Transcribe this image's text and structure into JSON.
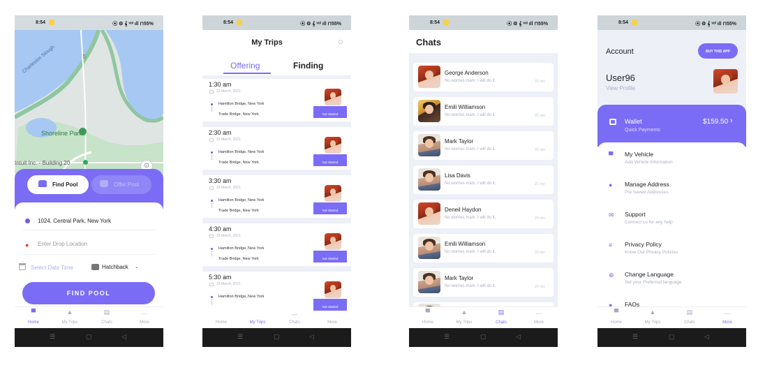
{
  "status_bar": {
    "time": "8:54",
    "icons": "⦿ ⚙ 𝄞 ᵛᵒˡ ıll ⊓55%"
  },
  "bottom_nav": {
    "home": "Home",
    "trips": "My Trips",
    "chats": "Chats",
    "more": "More"
  },
  "android_nav": {
    "menu": "☰",
    "home": "▢",
    "back": "◁"
  },
  "screen1": {
    "map": {
      "labels": [
        "Charleston Slough",
        "Shoreline Park",
        "Intuit Inc. - Building 20",
        "A1"
      ]
    },
    "tabs": {
      "find": "Find Pool",
      "offer": "Offer Pool"
    },
    "pickup": "1024, Central Park, New York",
    "drop_placeholder": "Enter Drop Location",
    "date_placeholder": "Select Date Time",
    "vehicle": "Hatchback",
    "button": "FIND POOL"
  },
  "screen2": {
    "title": "My Trips",
    "tabs": {
      "offering": "Offering",
      "finding": "Finding"
    },
    "trips": [
      {
        "time": "1:30 am",
        "date": "23 March, 2021",
        "from": "Hamilton Bridge, New York",
        "to": "Trade Bridge, New York",
        "status": "Not Started"
      },
      {
        "time": "2:30 am",
        "date": "23 March, 2021",
        "from": "Hamilton Bridge, New York",
        "to": "Trade Bridge, New York",
        "status": "Not Started"
      },
      {
        "time": "3:30 am",
        "date": "23 March, 2021",
        "from": "Hamilton Bridge, New York",
        "to": "Trade Bridge, New York",
        "status": "Not Started"
      },
      {
        "time": "4:30 am",
        "date": "23 March, 2021",
        "from": "Hamilton Bridge, New York",
        "to": "Trade Bridge, New York",
        "status": "Not Started"
      },
      {
        "time": "5:30 am",
        "date": "23 March, 2021",
        "from": "Hamilton Bridge, New York",
        "to": "",
        "status": "Not Started"
      }
    ]
  },
  "screen3": {
    "title": "Chats",
    "chats": [
      {
        "name": "George Anderson",
        "msg": "No worries mam. I will do it.",
        "time": "20 min",
        "avatar": "w"
      },
      {
        "name": "Emili Williamson",
        "msg": "No worries mam. I will do it.",
        "time": "20 min",
        "avatar": "w2"
      },
      {
        "name": "Mark Taylor",
        "msg": "No worries mam. I will do it.",
        "time": "20 min",
        "avatar": "m"
      },
      {
        "name": "Lisa Davis",
        "msg": "No worries mam. I will do it.",
        "time": "20 min",
        "avatar": "m"
      },
      {
        "name": "Deneil Haydon",
        "msg": "No worries mam. I will do it.",
        "time": "20 min",
        "avatar": "w"
      },
      {
        "name": "Emili Williamson",
        "msg": "No worries mam. I will do it.",
        "time": "20 min",
        "avatar": "m"
      },
      {
        "name": "Mark Taylor",
        "msg": "No worries mam. I will do it.",
        "time": "20 min",
        "avatar": "m"
      }
    ]
  },
  "screen4": {
    "title": "Account",
    "buy_button": "BUY THIS APP",
    "user": "User96",
    "view_profile": "View Profile",
    "wallet": {
      "label": "Wallet",
      "sub": "Quick Payments",
      "amount": "$159.50"
    },
    "menu": [
      {
        "icon": "car-icon",
        "glyph": "▀",
        "title": "My Vehicle",
        "sub": "Add Vehicle Information"
      },
      {
        "icon": "location-pin-icon",
        "glyph": "●",
        "title": "Manage Address",
        "sub": "Pre Saved Addresses"
      },
      {
        "icon": "mail-icon",
        "glyph": "✉",
        "title": "Support",
        "sub": "Connect us for any help"
      },
      {
        "icon": "privacy-icon",
        "glyph": "≡",
        "title": "Privacy Policy",
        "sub": "Know Our Privacy Policies"
      },
      {
        "icon": "globe-icon",
        "glyph": "⊕",
        "title": "Change Language",
        "sub": "Set your Preferred language"
      },
      {
        "icon": "faq-icon",
        "glyph": "●",
        "title": "FAQs",
        "sub": ""
      }
    ]
  }
}
